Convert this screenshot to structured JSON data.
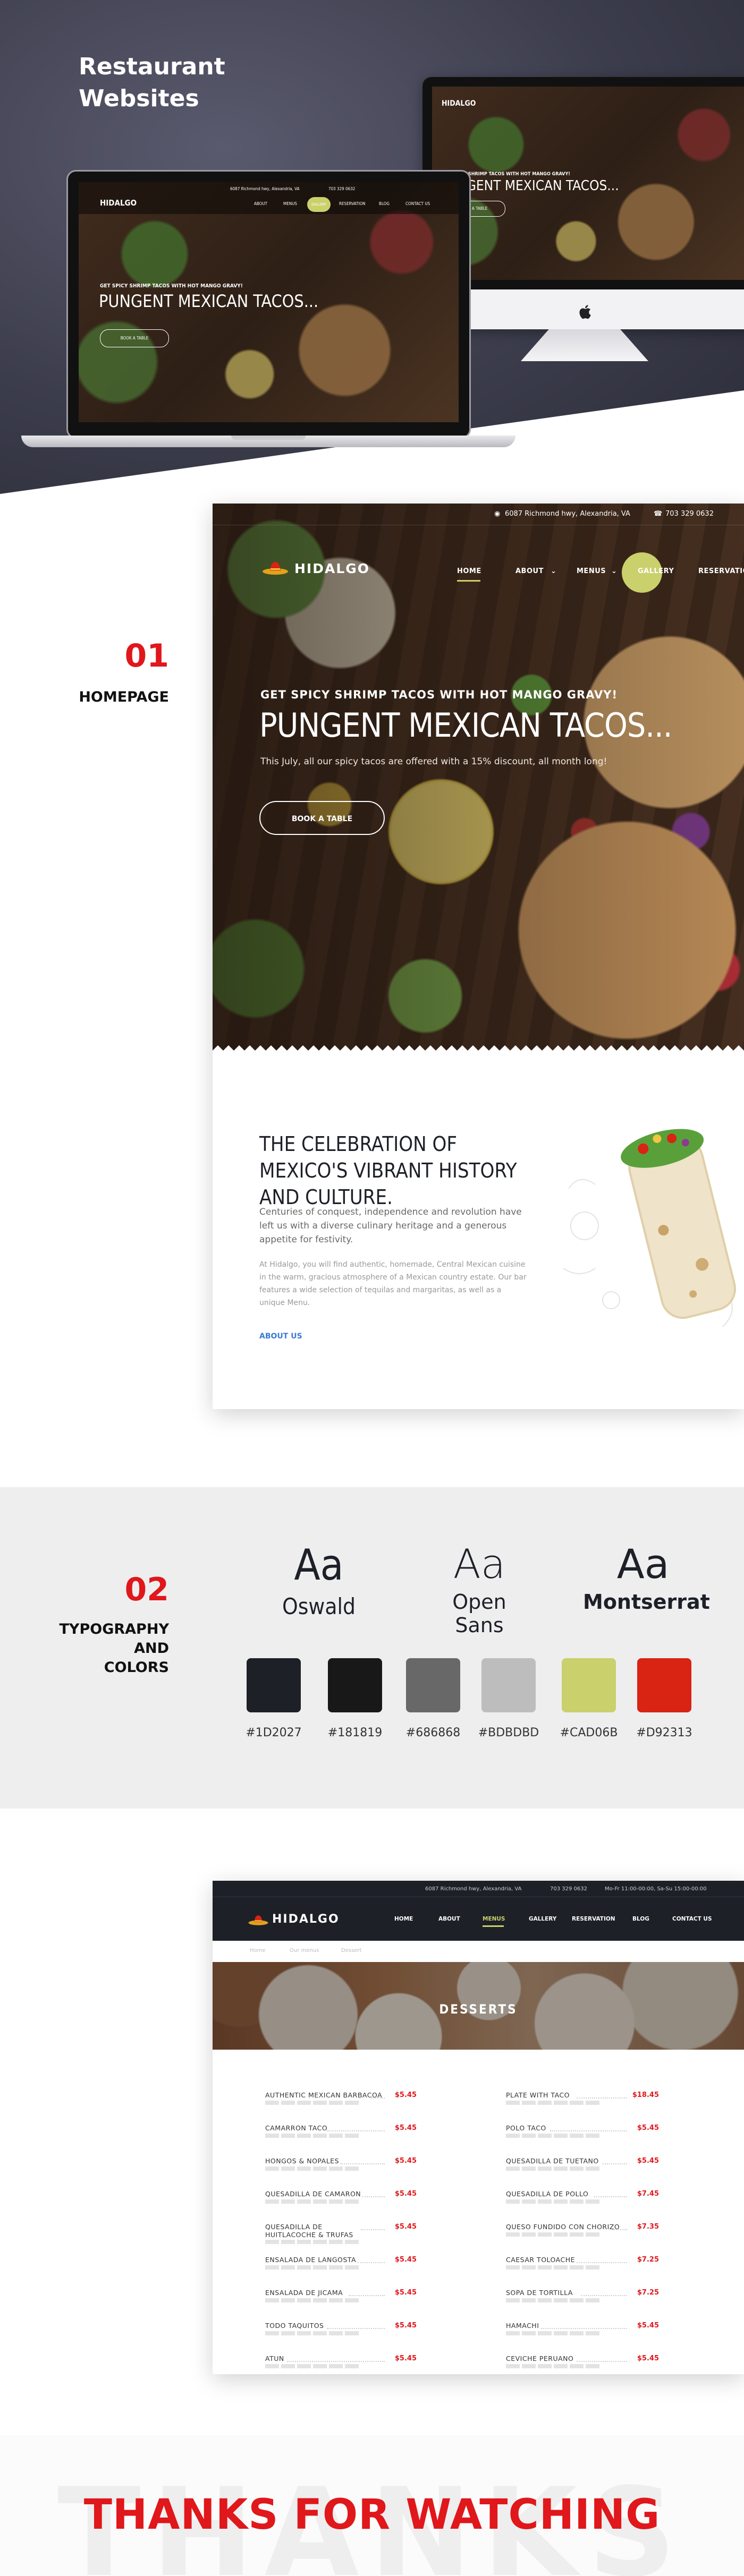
{
  "hero": {
    "title_line1": "Restaurant",
    "title_line2": "Websites"
  },
  "mini_site": {
    "brand": "HIDALGO",
    "address": "6087 Richmond hwy, Alexandria, VA",
    "phone": "703 329 0632",
    "kicker": "GET SPICY SHRIMP TACOS WITH HOT MANGO GRAVY!",
    "headline": "PUNGENT MEXICAN TACOS...",
    "button": "BOOK A TABLE",
    "nav": [
      "HOME",
      "ABOUT",
      "MENUS",
      "GALLERY",
      "RESERVATION",
      "BLOG",
      "CONTACT US"
    ]
  },
  "section_homepage": {
    "number": "01",
    "label": "HOMEPAGE"
  },
  "homepage": {
    "brand": "HIDALGO",
    "address": "6087 Richmond hwy, Alexandria, VA",
    "phone": "703 329 0632",
    "nav": {
      "home": "HOME",
      "about": "ABOUT",
      "menus": "MENUS",
      "gallery": "GALLERY",
      "reservation": "RESERVATIO"
    },
    "kicker": "GET SPICY SHRIMP TACOS WITH HOT MANGO GRAVY!",
    "headline": "PUNGENT MEXICAN TACOS...",
    "subtext": "This July, all our spicy tacos are offered with a 15% discount, all month long!",
    "button": "BOOK A TABLE",
    "about_title": "THE CELEBRATION OF MEXICO'S VIBRANT HISTORY AND CULTURE.",
    "about_lead": "Centuries of conquest, independence and revolution have left us with a diverse culinary heritage and a generous appetite for festivity.",
    "about_body": "At Hidalgo, you will find authentic, homemade, Central Mexican cuisine in the warm, gracious atmosphere of a Mexican country estate. Our bar features a wide selection of tequilas and margaritas, as well as a unique Menu.",
    "about_link": "ABOUT US"
  },
  "section_typography": {
    "number": "02",
    "label_line1": "TYPOGRAPHY",
    "label_line2": "AND",
    "label_line3": "COLORS"
  },
  "fonts": [
    {
      "sample": "Aa",
      "name": "Oswald"
    },
    {
      "sample": "Aa",
      "name": "Open Sans"
    },
    {
      "sample": "Aa",
      "name": "Montserrat"
    }
  ],
  "colors": [
    {
      "hex": "#1D2027",
      "label": "#1D2027"
    },
    {
      "hex": "#181819",
      "label": "#181819"
    },
    {
      "hex": "#686868",
      "label": "#686868"
    },
    {
      "hex": "#BDBDBD",
      "label": "#BDBDBD"
    },
    {
      "hex": "#CAD06B",
      "label": "#CAD06B"
    },
    {
      "hex": "#D92313",
      "label": "#D92313"
    }
  ],
  "menu_page": {
    "brand": "HIDALGO",
    "address": "6087 Richmond hwy, Alexandria, VA",
    "phone": "703 329 0632",
    "hours": "Mo-Fr 11:00-00:00, Sa-Su 15:00-00:00",
    "nav": {
      "home": "HOME",
      "about": "ABOUT",
      "menus": "MENUS",
      "gallery": "GALLERY",
      "reservation": "RESERVATION",
      "blog": "BLOG",
      "contact": "CONTACT US"
    },
    "crumbs": [
      "Home",
      "Our menus",
      "Dessert"
    ],
    "banner_title": "DESSERTS",
    "left_items": [
      {
        "name": "AUTHENTIC MEXICAN BARBACOA",
        "price": "$5.45"
      },
      {
        "name": "CAMARRON TACO",
        "price": "$5.45"
      },
      {
        "name": "HONGOS & NOPALES",
        "price": "$5.45"
      },
      {
        "name": "QUESADILLA DE CAMARON",
        "price": "$5.45"
      },
      {
        "name": "QUESADILLA DE HUITLACOCHE & TRUFAS",
        "price": "$5.45"
      },
      {
        "name": "ENSALADA DE LANGOSTA",
        "price": "$5.45"
      },
      {
        "name": "ENSALADA DE JICAMA",
        "price": "$5.45"
      },
      {
        "name": "TODO TAQUITOS",
        "price": "$5.45"
      },
      {
        "name": "ATUN",
        "price": "$5.45"
      }
    ],
    "right_items": [
      {
        "name": "PLATE WITH TACO",
        "price": "$18.45"
      },
      {
        "name": "POLO TACO",
        "price": "$5.45"
      },
      {
        "name": "QUESADILLA DE TUETANO",
        "price": "$5.45"
      },
      {
        "name": "QUESADILLA DE POLLO",
        "price": "$7.45"
      },
      {
        "name": "QUESO FUNDIDO CON CHORIZO",
        "price": "$7.35"
      },
      {
        "name": "CAESAR TOLOACHE",
        "price": "$7.25"
      },
      {
        "name": "SOPA DE TORTILLA",
        "price": "$7.25"
      },
      {
        "name": "HAMACHI",
        "price": "$5.45"
      },
      {
        "name": "CEVICHE PERUANO",
        "price": "$5.45"
      }
    ]
  },
  "thanks": {
    "ghost": "THANKS",
    "message": "THANKS FOR WATCHING"
  }
}
